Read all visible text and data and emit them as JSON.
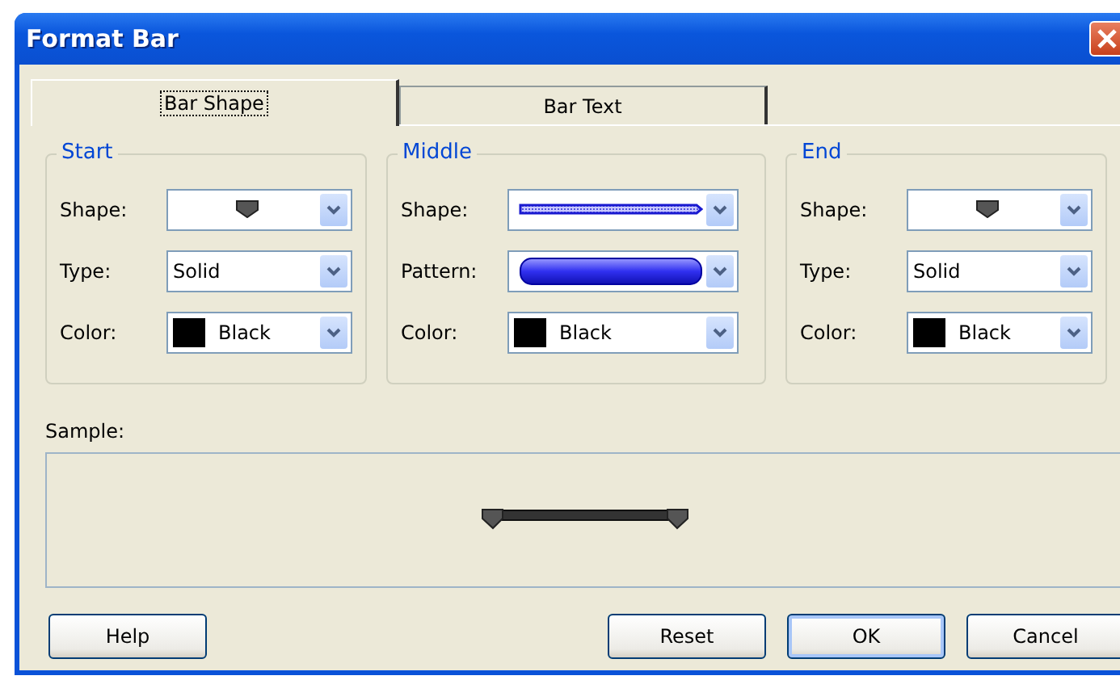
{
  "window": {
    "title": "Format Bar"
  },
  "tabs": [
    {
      "label": "Bar Shape",
      "selected": true
    },
    {
      "label": "Bar Text",
      "selected": false
    }
  ],
  "groups": [
    {
      "title": "Start",
      "fields": [
        {
          "label": "Shape:",
          "kind": "shape"
        },
        {
          "label": "Type:",
          "kind": "text",
          "value": "Solid"
        },
        {
          "label": "Color:",
          "kind": "color",
          "value": "Black",
          "color": "#000000"
        }
      ]
    },
    {
      "title": "Middle",
      "fields": [
        {
          "label": "Shape:",
          "kind": "line"
        },
        {
          "label": "Pattern:",
          "kind": "pattern"
        },
        {
          "label": "Color:",
          "kind": "color",
          "value": "Black",
          "color": "#000000"
        }
      ]
    },
    {
      "title": "End",
      "fields": [
        {
          "label": "Shape:",
          "kind": "shape"
        },
        {
          "label": "Type:",
          "kind": "text",
          "value": "Solid"
        },
        {
          "label": "Color:",
          "kind": "color",
          "value": "Black",
          "color": "#000000"
        }
      ]
    }
  ],
  "sample": {
    "label": "Sample:"
  },
  "buttons": [
    {
      "label": "Help",
      "default": false
    },
    {
      "label": "Reset",
      "default": false
    },
    {
      "label": "OK",
      "default": true
    },
    {
      "label": "Cancel",
      "default": false
    }
  ]
}
